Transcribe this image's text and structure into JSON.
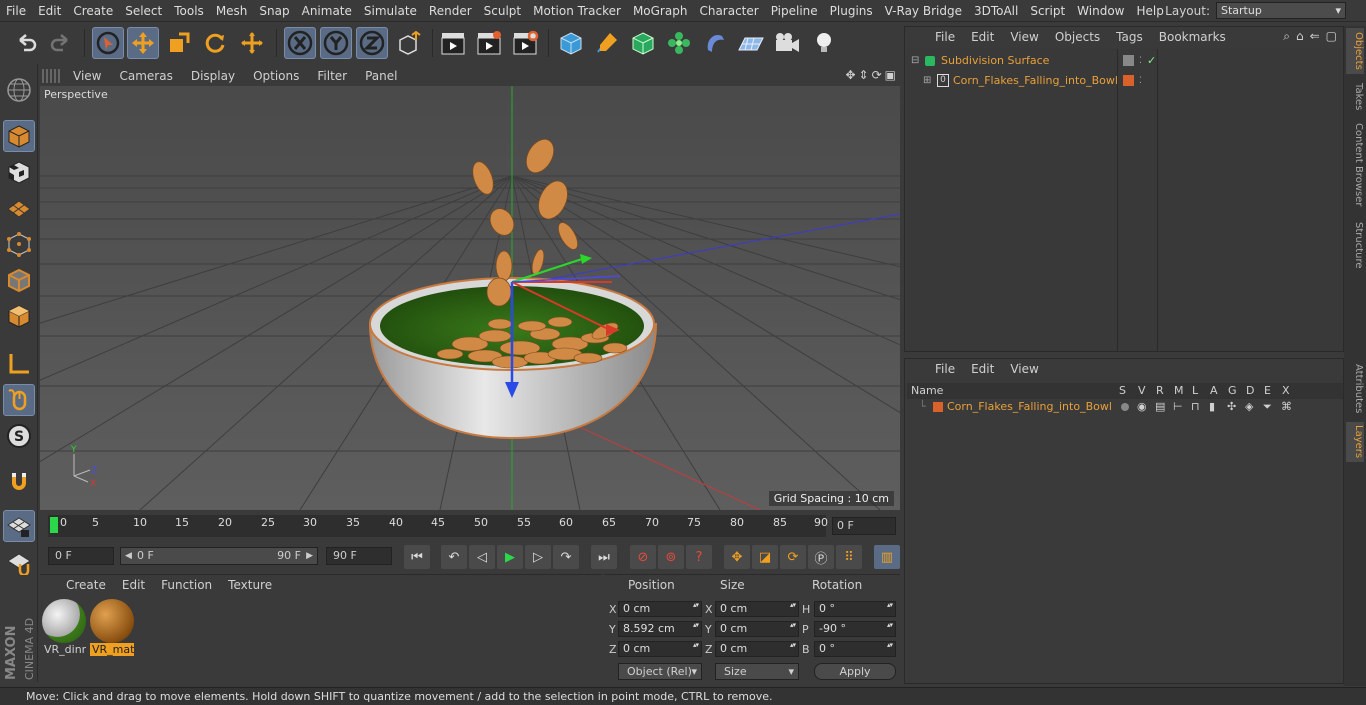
{
  "menubar": {
    "items": [
      "File",
      "Edit",
      "Create",
      "Select",
      "Tools",
      "Mesh",
      "Snap",
      "Animate",
      "Simulate",
      "Render",
      "Sculpt",
      "Motion Tracker",
      "MoGraph",
      "Character",
      "Pipeline",
      "Plugins",
      "V-Ray Bridge",
      "3DToAll",
      "Script",
      "Window",
      "Help"
    ],
    "layout_label": "Layout:",
    "layout_value": "Startup"
  },
  "viewport": {
    "menu": [
      "View",
      "Cameras",
      "Display",
      "Options",
      "Filter",
      "Panel"
    ],
    "camera_label": "Perspective",
    "grid_spacing": "Grid Spacing : 10 cm"
  },
  "timeline": {
    "ticks": [
      "0",
      "5",
      "10",
      "15",
      "20",
      "25",
      "30",
      "35",
      "40",
      "45",
      "50",
      "55",
      "60",
      "65",
      "70",
      "75",
      "80",
      "85",
      "90"
    ],
    "current_frame": "0 F"
  },
  "playback": {
    "start": "0 F",
    "range_start": "0 F",
    "range_end": "90 F",
    "end": "90 F"
  },
  "materials": {
    "menu": [
      "Create",
      "Edit",
      "Function",
      "Texture"
    ],
    "items": [
      {
        "label": "VR_dinr"
      },
      {
        "label": "VR_mat"
      }
    ]
  },
  "coords": {
    "headers": {
      "position": "Position",
      "size": "Size",
      "rotation": "Rotation"
    },
    "rows": [
      {
        "axis": "X",
        "pos": "0 cm",
        "saxis": "X",
        "size": "0 cm",
        "raxis": "H",
        "rot": "0 °"
      },
      {
        "axis": "Y",
        "pos": "8.592 cm",
        "saxis": "Y",
        "size": "0 cm",
        "raxis": "P",
        "rot": "-90 °"
      },
      {
        "axis": "Z",
        "pos": "0 cm",
        "saxis": "Z",
        "size": "0 cm",
        "raxis": "B",
        "rot": "0 °"
      }
    ],
    "mode_dropdown": "Object (Rel)",
    "size_dropdown": "Size",
    "apply_label": "Apply"
  },
  "objects": {
    "menu": [
      "File",
      "Edit",
      "View",
      "Objects",
      "Tags",
      "Bookmarks"
    ],
    "items": [
      {
        "name": "Subdivision Surface"
      },
      {
        "name": "Corn_Flakes_Falling_into_Bowl"
      }
    ]
  },
  "layers": {
    "menu": [
      "File",
      "Edit",
      "View"
    ],
    "columns": {
      "name": "Name",
      "s": "S",
      "v": "V",
      "r": "R",
      "m": "M",
      "l": "L",
      "a": "A",
      "g": "G",
      "d": "D",
      "e": "E",
      "x": "X"
    },
    "items": [
      {
        "name": "Corn_Flakes_Falling_into_Bowl"
      }
    ]
  },
  "sidetabs": [
    "Objects",
    "Takes",
    "Content Browser",
    "Structure",
    "Attributes",
    "Layers"
  ],
  "status": "Move: Click and drag to move elements. Hold down SHIFT to quantize movement / add to the selection in point mode, CTRL to remove.",
  "branding": {
    "company": "MAXON",
    "product": "CINEMA 4D"
  },
  "colors": {
    "accent": "#e8a03a",
    "selection": "#5a6c85",
    "layer_color": "#d9612a"
  }
}
